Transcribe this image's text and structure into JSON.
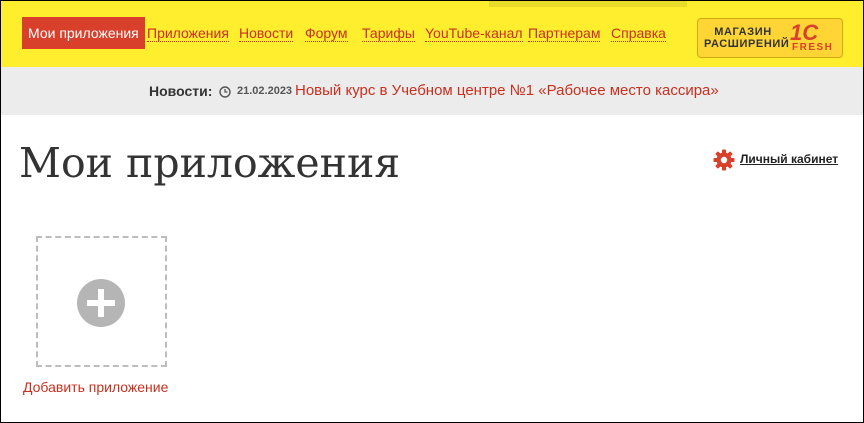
{
  "nav": {
    "active_label": "Мои приложения",
    "links": [
      "Приложения",
      "Новости",
      "Форум",
      "Тарифы",
      "YouTube-канал",
      "Партнерам",
      "Справка"
    ]
  },
  "store": {
    "line1": "МАГАЗИН",
    "line2": "РАСШИРЕНИЙ",
    "logo_text": "1С",
    "logo_sub": "FRESH"
  },
  "news": {
    "label": "Новости:",
    "date": "21.02.2023",
    "headline": "Новый курс в Учебном центре №1 «Рабочее место кассира»"
  },
  "page": {
    "title": "Мои приложения",
    "cabinet_label": "Личный кабинет"
  },
  "apps": {
    "add_label": "Добавить приложение"
  },
  "colors": {
    "header_bg": "#ffee2d",
    "accent_red": "#d9402b",
    "news_bg": "#ececec"
  },
  "icons": {
    "clock": "clock-icon",
    "gear": "gear-icon",
    "plus": "plus-circle-icon"
  }
}
